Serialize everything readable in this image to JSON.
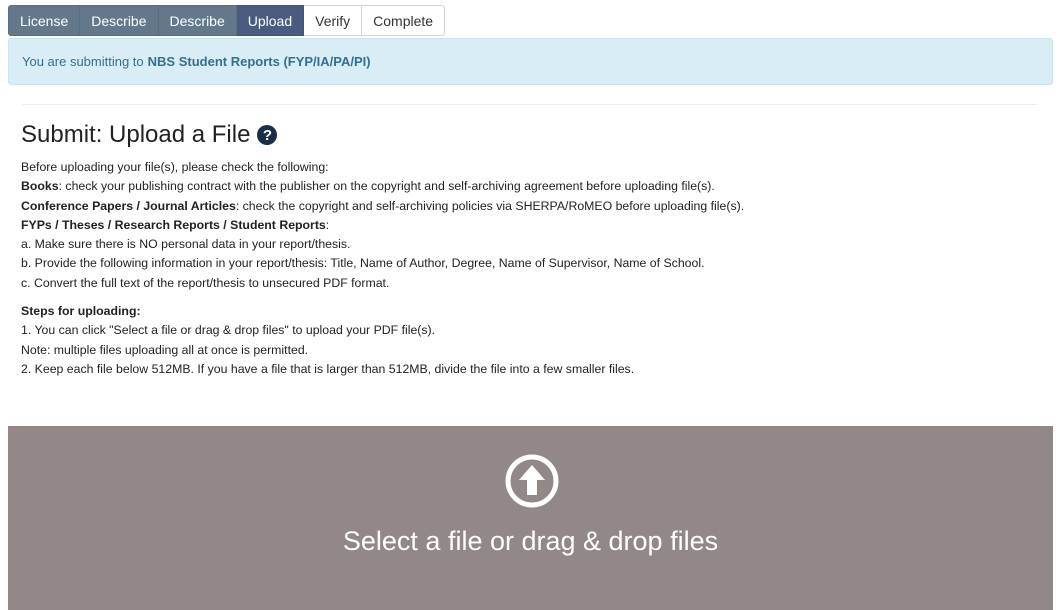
{
  "wizard": {
    "steps": [
      {
        "label": "License",
        "state": "done"
      },
      {
        "label": "Describe",
        "state": "done"
      },
      {
        "label": "Describe",
        "state": "done"
      },
      {
        "label": "Upload",
        "state": "active"
      },
      {
        "label": "Verify",
        "state": "todo"
      },
      {
        "label": "Complete",
        "state": "todo"
      }
    ]
  },
  "alert": {
    "prefix": "You are submitting to",
    "collection": "NBS Student Reports (FYP/IA/PA/PI)"
  },
  "page": {
    "title": "Submit: Upload a File"
  },
  "instructions": {
    "intro": "Before uploading your file(s), please check the following:",
    "books_label": "Books",
    "books_text": ": check your publishing contract with the publisher on the copyright and self-archiving agreement before uploading file(s).",
    "papers_label": "Conference Papers / Journal Articles",
    "papers_text": ": check the copyright and self-archiving policies via SHERPA/RoMEO before uploading file(s).",
    "reports_label": "FYPs / Theses / Research Reports / Student Reports",
    "reports_text": ":",
    "item_a": "a. Make sure there is NO personal data in your report/thesis.",
    "item_b": "b. Provide the following information in your report/thesis: Title, Name of Author, Degree, Name of Supervisor, Name of School.",
    "item_c": "c. Convert the full text of the report/thesis to unsecured PDF format."
  },
  "steps": {
    "heading": "Steps for uploading:",
    "step1": "1. You can click \"Select a file or drag & drop files\" to upload your PDF file(s).",
    "note": "Note: multiple files uploading all at once is permitted.",
    "step2": "2. Keep each file below 512MB. If you have a file that is larger than 512MB, divide the file into a few smaller files."
  },
  "dropzone": {
    "label": "Select a file or drag & drop files",
    "icon": "upload-arrow-circle-icon",
    "background": "#928887"
  },
  "colors": {
    "step_done": "#63788a",
    "step_active": "#4a5b80",
    "alert_bg": "#d9edf7",
    "alert_text": "#31708f"
  }
}
